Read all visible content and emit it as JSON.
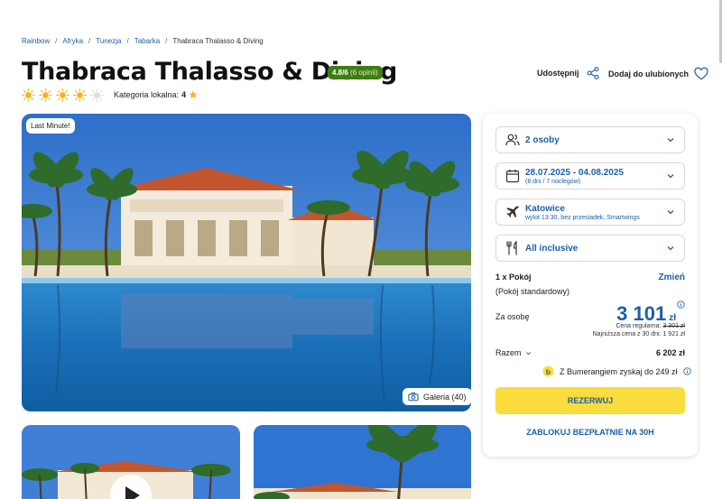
{
  "breadcrumb": [
    "Rainbow",
    "Afryka",
    "Tunezja",
    "Tabarka",
    "Thabraca Thalasso & Diving"
  ],
  "hotel": {
    "title": "Thabraca Thalasso & Diving",
    "rating": "4.8/6",
    "rating_reviews": "(6 opinii)",
    "suns_count": 4,
    "suns_max": 5,
    "local_category_label": "Kategoria lokalna:",
    "local_category_value": "4"
  },
  "actions": {
    "share_label": "Udostępnij",
    "favourite_label": "Dodaj do ulubionych",
    "share_icon": "share-icon",
    "favourite_icon": "heart-icon"
  },
  "gallery": {
    "badge": "Last Minute!",
    "gallery_button": "Galeria (40)"
  },
  "booking": {
    "persons": "2 osoby",
    "dates": "28.07.2025 - 04.08.2025",
    "dates_sub": "(8 dni / 7 noclegów)",
    "departure": "Katowice",
    "departure_sub": "wylot 13:30, bez przesiadek, Smartwings",
    "board": "All inclusive",
    "room_count": "1 x Pokój",
    "change_label": "Zmień",
    "room_type": "(Pokój standardowy)",
    "per_person_label": "Za osobę",
    "price": "3 101",
    "currency": "zł",
    "regular_price_label": "Cena regularna:",
    "regular_price": "3 301 zł",
    "lowest_price_label": "Najniższa cena z 30 dni:",
    "lowest_price": "1 921 zł",
    "total_label": "Razem",
    "total_value": "6 202 zł",
    "bumerang_text": "Z Bumerangiem zyskaj do 249 zł",
    "book_button": "REZERWUJ",
    "block_button": "ZABLOKUJ BEZPŁATNIE NA 30H"
  },
  "colors": {
    "accent": "#1d5fa8",
    "book_button": "#fadc3c",
    "rating_badge": "#3f7d12",
    "sun": "#f6b417"
  }
}
